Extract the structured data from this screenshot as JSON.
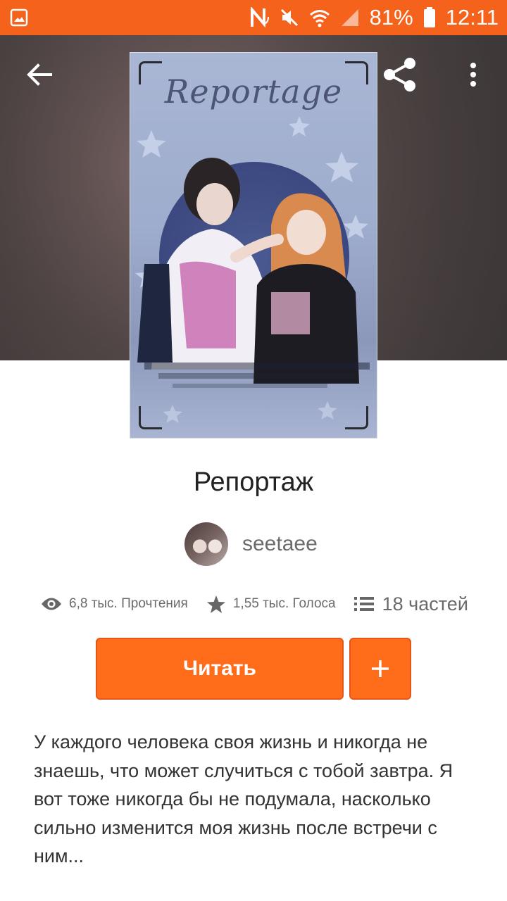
{
  "status_bar": {
    "battery": "81%",
    "time": "12:11",
    "icons": [
      "gallery-icon",
      "nfc-icon",
      "mute-icon",
      "wifi-icon",
      "signal-icon",
      "battery-icon"
    ]
  },
  "header": {
    "back_icon": "arrow-left-icon",
    "share_icon": "share-icon",
    "more_icon": "more-vert-icon"
  },
  "cover": {
    "title_text": "Reportage"
  },
  "story": {
    "title": "Репортаж",
    "author": "seetaee",
    "stats": {
      "reads": "6,8 тыс. Прочтения",
      "votes": "1,55 тыс. Голоса",
      "parts": "18 частей"
    },
    "read_button": "Читать",
    "add_button_icon": "plus-icon",
    "description": "У каждого человека своя жизнь и никогда не знаешь, что может случиться с тобой завтра. Я вот тоже никогда бы не подумала, насколько сильно изменится моя жизнь после встречи с ним..."
  },
  "colors": {
    "accent": "#ff6c1a",
    "status_bar": "#f4621c"
  }
}
